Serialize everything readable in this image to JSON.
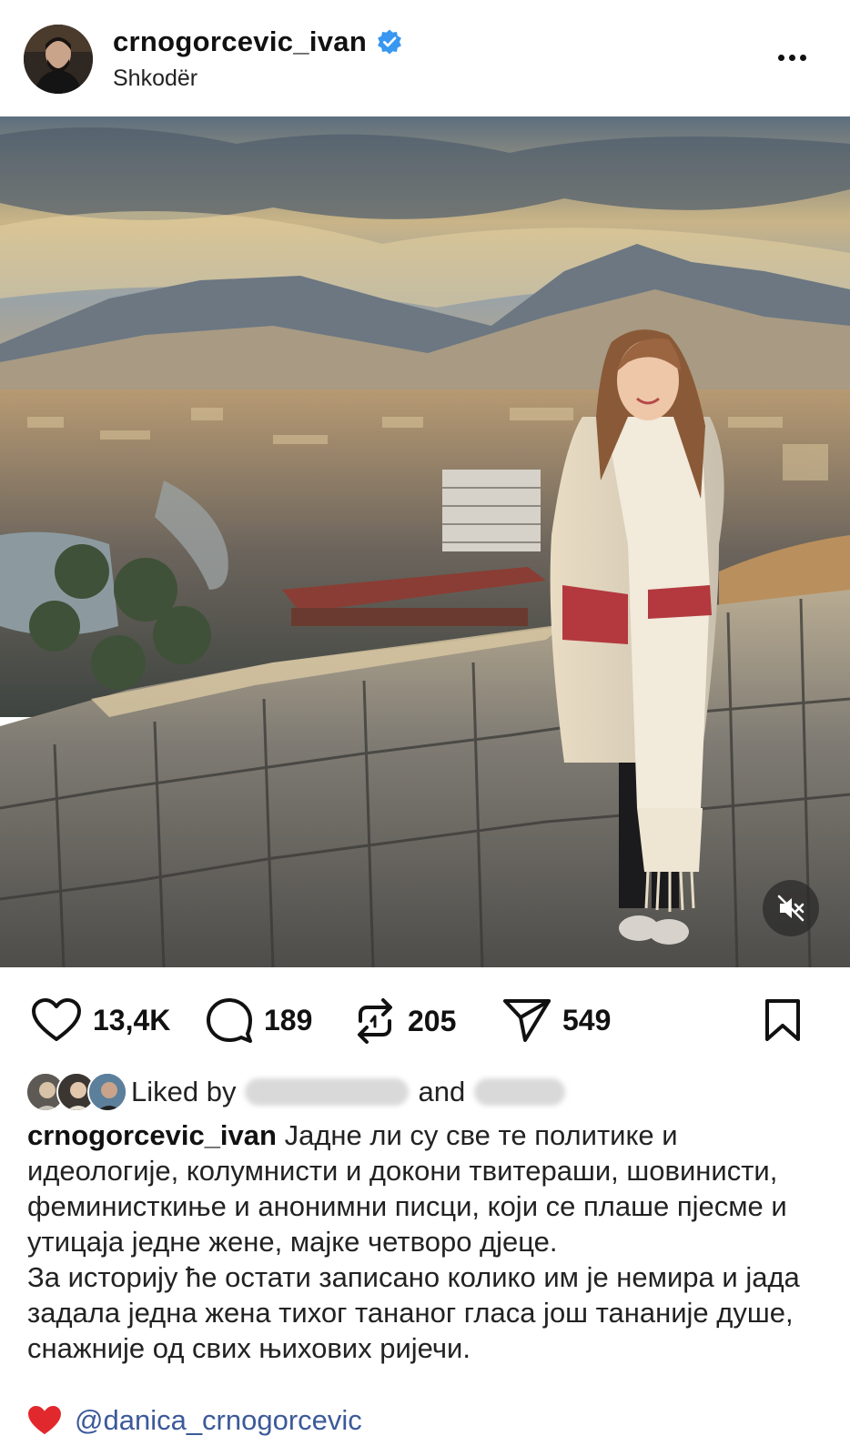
{
  "post": {
    "username": "crnogorcevic_ivan",
    "location": "Shkodër",
    "verified": true
  },
  "icons": {
    "verified": "verified-badge-icon",
    "more": "more-options-icon",
    "like": "heart-icon",
    "comment": "comment-bubble-icon",
    "repost": "repost-icon",
    "share": "send-icon",
    "save": "bookmark-icon",
    "mute": "muted-speaker-icon"
  },
  "actions": {
    "likes": "13,4K",
    "comments": "189",
    "reposts": "205",
    "shares": "549"
  },
  "liked_by": {
    "prefix": "Liked by",
    "connector": "and"
  },
  "caption": {
    "username": "crnogorcevic_ivan",
    "paragraph1": "Јадне ли су све те политике и идеологије, колумнисти и докони твитераши, шовинисти, феминисткиње и анонимни писци, који се плаше пјесме и утицаја једне жене, мајке четворо дјеце.",
    "paragraph2": "За историју ће остати записано колико им је немира и јада задала једна жена тихог тананог гласа још тананије душе, снажније од свих њихових ријечи.",
    "mention": "@danica_crnogorcevic"
  },
  "colors": {
    "verified_blue": "#3897f0",
    "mention_blue": "#3c5a99",
    "heart_red": "#e0282d",
    "text": "#111111"
  }
}
